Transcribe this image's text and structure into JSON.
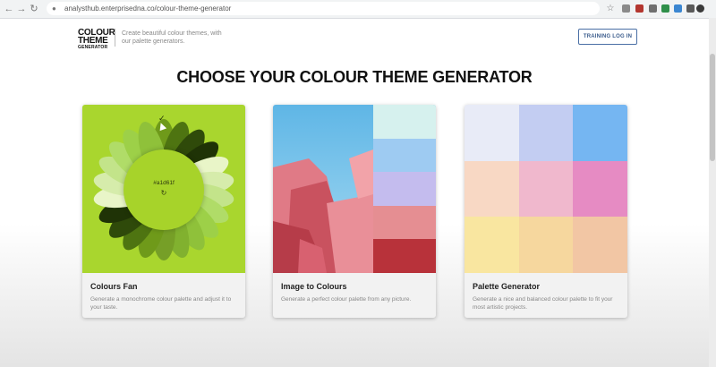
{
  "browser": {
    "url": "analysthub.enterprisedna.co/colour-theme-generator"
  },
  "header": {
    "logo_line1": "COLOUR",
    "logo_line2": "THEME",
    "logo_line3": "GENERATOR",
    "tagline": "Create beautiful colour themes, with our palette generators.",
    "login_label": "TRAINING LOG IN"
  },
  "page_title": "CHOOSE YOUR COLOUR THEME GENERATOR",
  "cards": [
    {
      "title": "Colours Fan",
      "description": "Generate a monochrome colour palette and adjust it to your taste.",
      "hex": "#a1d61f"
    },
    {
      "title": "Image to Colours",
      "description": "Generate a perfect colour palette from any picture."
    },
    {
      "title": "Palette Generator",
      "description": "Generate a nice and balanced colour palette to fit your most artistic projects."
    }
  ],
  "image_palette": [
    "#d6f1ee",
    "#9ecbf2",
    "#c4bcee",
    "#e58e92",
    "#b8323a"
  ],
  "palette_grid": [
    [
      "#e8ebf7",
      "#c3cdf2",
      "#75b6f2"
    ],
    [
      "#f8d8c4",
      "#f0b8cd",
      "#e68bc3"
    ],
    [
      "#f9e6a0",
      "#f6d79e",
      "#f2c6a4"
    ]
  ],
  "icons": [
    "back-icon",
    "forward-icon",
    "reload-icon",
    "lock-icon",
    "star-icon",
    "refresh-icon",
    "check-icon"
  ]
}
